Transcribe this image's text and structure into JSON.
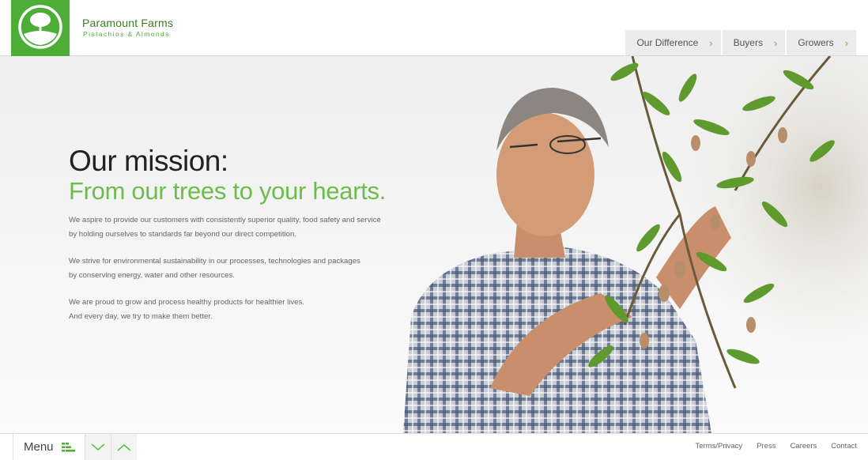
{
  "brand": {
    "name": "Paramount Farms",
    "tagline": "Pistachios & Almonds",
    "accent_color": "#4cae36",
    "logo_icon": "tree-logo-icon"
  },
  "nav": {
    "items": [
      {
        "label": "Our Difference",
        "icon": "chevron-right-icon"
      },
      {
        "label": "Buyers",
        "icon": "chevron-right-icon"
      },
      {
        "label": "Growers",
        "icon": "chevron-right-icon"
      }
    ]
  },
  "hero": {
    "heading": "Our mission:",
    "subheading": "From our trees to your hearts.",
    "heading_color": "#222222",
    "subheading_color": "#6cbd4a",
    "paragraphs": [
      {
        "line1": "We aspire to provide our customers with consistently superior quality, food safety and service",
        "line2": "by holding ourselves to standards far beyond our direct competition."
      },
      {
        "line1": "We strive for environmental sustainability in our processes, technologies and packages",
        "line2": "by conserving energy, water and other resources."
      },
      {
        "line1": "We are proud to grow and process healthy products for healthier lives.",
        "line2": "And every day, we try to make them better."
      }
    ]
  },
  "footer": {
    "menu_label": "Menu",
    "menu_icon": "menu-bars-icon",
    "down_icon": "chevron-down-icon",
    "up_icon": "chevron-up-icon",
    "links": [
      "Terms/Privacy",
      "Press",
      "Careers",
      "Contact"
    ]
  }
}
